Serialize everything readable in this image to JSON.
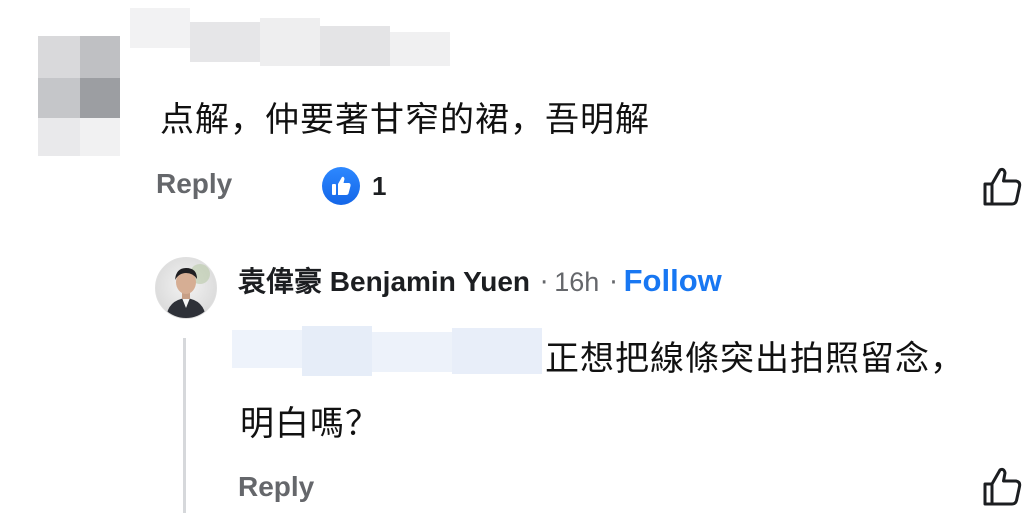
{
  "comment": {
    "text": "点解，仲要著甘窄的裙，吾明解",
    "reply_label": "Reply",
    "reaction": {
      "icon": "like-icon",
      "count": "1",
      "color": "#1877f2"
    },
    "like_icon": "thumbs-up-outline-icon"
  },
  "reply": {
    "author": "袁偉豪 Benjamin Yuen",
    "separator": "·",
    "time": "16h",
    "follow_label": "Follow",
    "text_line1": "正想把線條突出拍照留念，",
    "text_line2": "明白嗎？",
    "reply_label": "Reply",
    "like_icon": "thumbs-up-outline-icon"
  },
  "colors": {
    "link_blue": "#1877f2",
    "secondary_text": "#65676b",
    "primary_text": "#1c1e21"
  }
}
